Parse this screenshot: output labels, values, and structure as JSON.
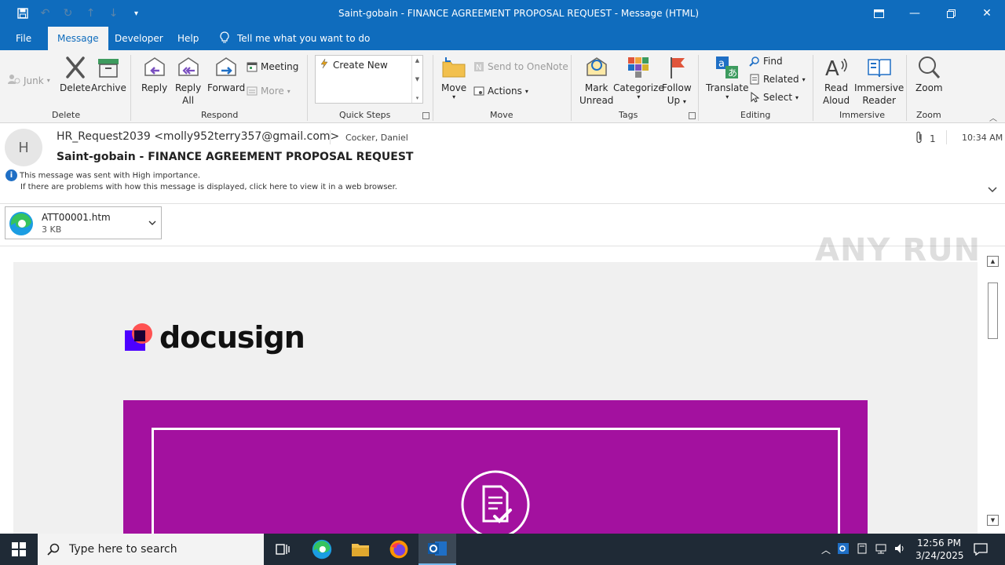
{
  "window": {
    "title": "Saint-gobain - FINANCE AGREEMENT PROPOSAL REQUEST  -  Message (HTML)"
  },
  "menu": {
    "tabs": [
      "File",
      "Message",
      "Developer",
      "Help"
    ],
    "active_tab": "Message",
    "tell_me": "Tell me what you want to do"
  },
  "ribbon": {
    "delete_group": {
      "label": "Delete",
      "junk": "Junk",
      "delete": "Delete",
      "archive": "Archive"
    },
    "respond_group": {
      "label": "Respond",
      "reply": "Reply",
      "reply_all_1": "Reply",
      "reply_all_2": "All",
      "forward": "Forward",
      "meeting": "Meeting",
      "more": "More"
    },
    "quicksteps_group": {
      "label": "Quick Steps",
      "create_new": "Create New"
    },
    "move_group": {
      "label": "Move",
      "move": "Move",
      "onenote": "Send to OneNote",
      "actions": "Actions"
    },
    "tags_group": {
      "label": "Tags",
      "mark_unread_1": "Mark",
      "mark_unread_2": "Unread",
      "categorize": "Categorize",
      "follow_up_1": "Follow",
      "follow_up_2": "Up"
    },
    "editing_group": {
      "label": "Editing",
      "translate": "Translate",
      "find": "Find",
      "related": "Related",
      "select": "Select"
    },
    "immersive_group": {
      "label": "Immersive",
      "read_aloud_1": "Read",
      "read_aloud_2": "Aloud",
      "immersive_reader_1": "Immersive",
      "immersive_reader_2": "Reader"
    },
    "zoom_group": {
      "label": "Zoom",
      "zoom": "Zoom"
    }
  },
  "message": {
    "avatar_initial": "H",
    "sender": "HR_Request2039 <molly952terry357@gmail.com>",
    "recipient": "Cocker, Daniel",
    "attachment_count": "1",
    "time": "10:34 AM",
    "subject": "Saint-gobain - FINANCE AGREEMENT PROPOSAL REQUEST",
    "importance_note": "This message was sent with High importance.",
    "display_note": "If there are problems with how this message is displayed, click here to view it in a web browser."
  },
  "attachment": {
    "name": "ATT00001.htm",
    "size": "3 KB"
  },
  "email_body": {
    "logo_text": "docusign",
    "banner_color": "#a3119f"
  },
  "watermark": "ANY RUN",
  "taskbar": {
    "search_placeholder": "Type here to search",
    "time": "12:56 PM",
    "date": "3/24/2025"
  },
  "colors": {
    "accent": "#0f6cbd",
    "taskbar": "#1f2a36"
  }
}
